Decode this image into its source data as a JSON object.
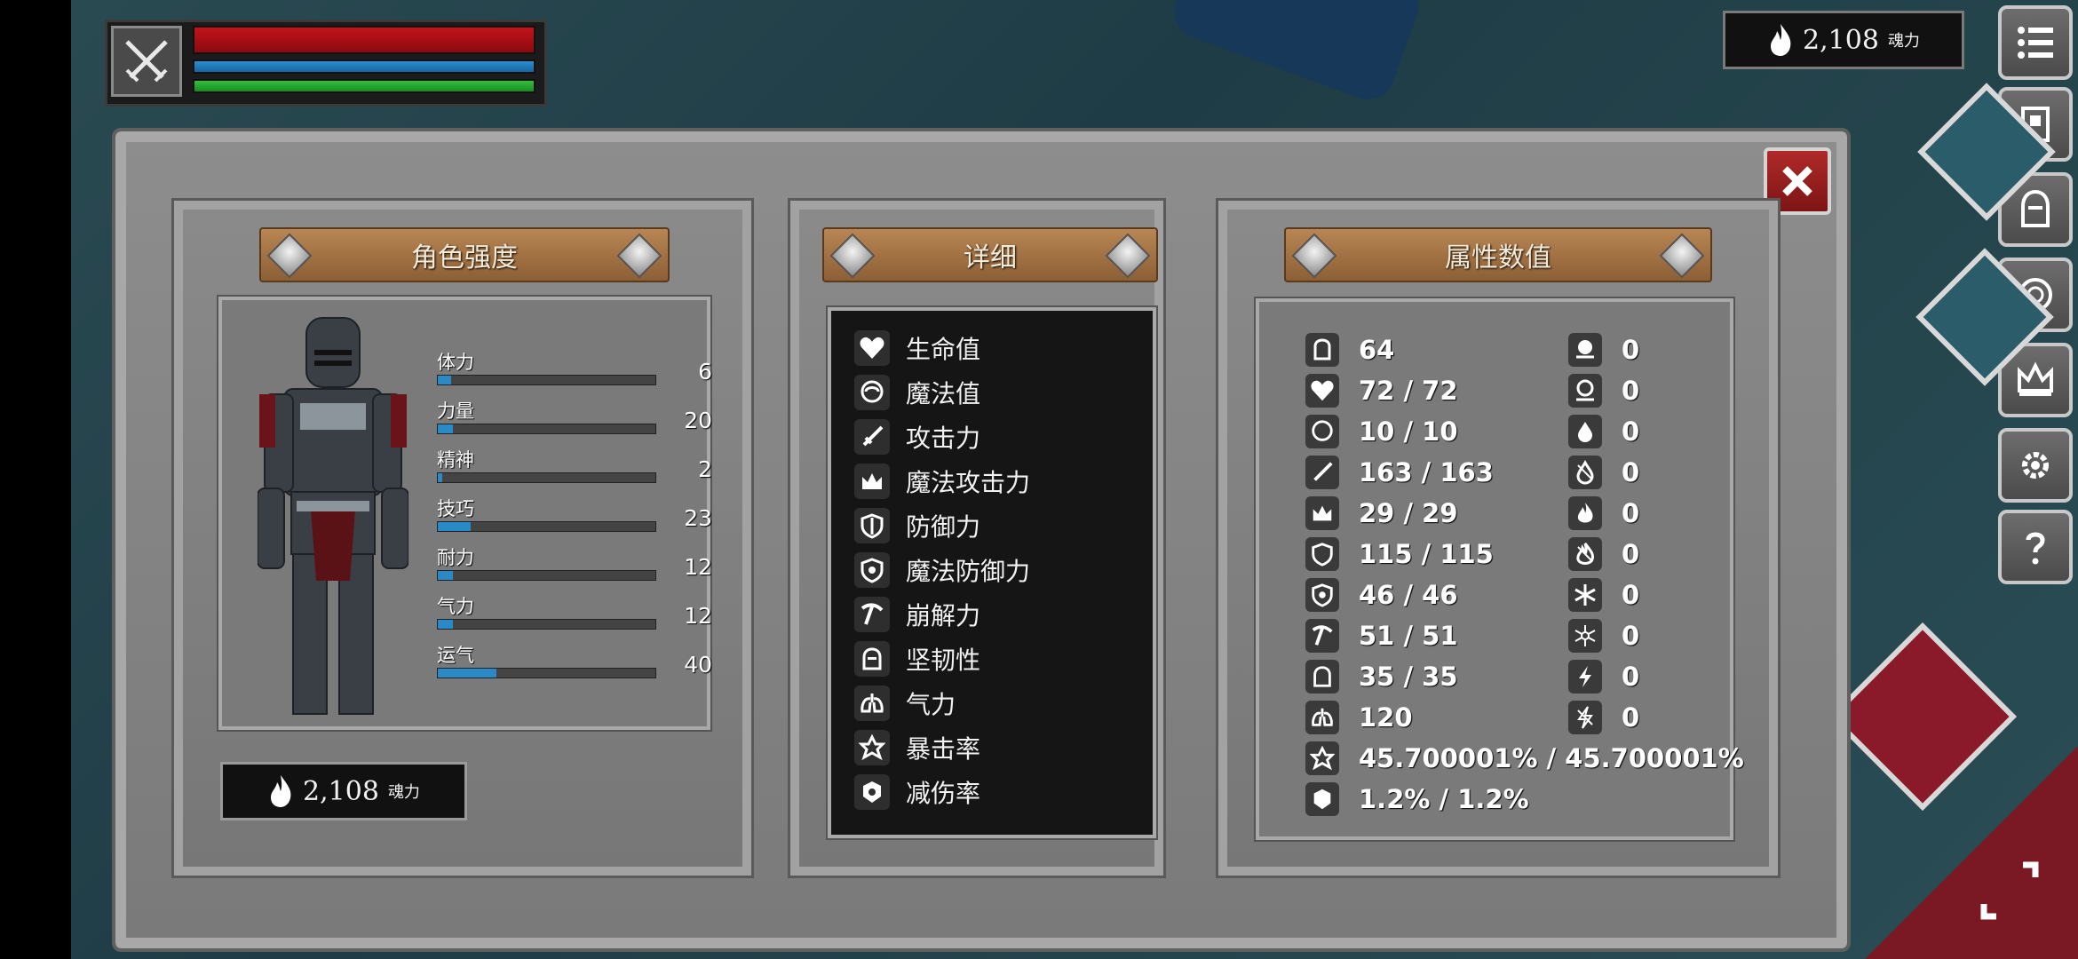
{
  "hud": {
    "soul_value": "2,108",
    "soul_unit": "魂力"
  },
  "panel": {
    "character": {
      "title": "角色强度",
      "stats": [
        {
          "label": "体力",
          "value": "6",
          "fill": 0.06
        },
        {
          "label": "力量",
          "value": "20",
          "fill": 0.07
        },
        {
          "label": "精神",
          "value": "2",
          "fill": 0.02
        },
        {
          "label": "技巧",
          "value": "23",
          "fill": 0.15
        },
        {
          "label": "耐力",
          "value": "12",
          "fill": 0.07
        },
        {
          "label": "气力",
          "value": "12",
          "fill": 0.07
        },
        {
          "label": "运气",
          "value": "40",
          "fill": 0.27
        }
      ],
      "soul_value": "2,108",
      "soul_unit": "魂力"
    },
    "detail": {
      "title": "详细",
      "items": [
        {
          "label": "生命值",
          "icon": "heart-icon"
        },
        {
          "label": "魔法值",
          "icon": "head-icon"
        },
        {
          "label": "攻击力",
          "icon": "sword-icon"
        },
        {
          "label": "魔法攻击力",
          "icon": "crown-icon"
        },
        {
          "label": "防御力",
          "icon": "shield-icon"
        },
        {
          "label": "魔法防御力",
          "icon": "magic-shield-icon"
        },
        {
          "label": "崩解力",
          "icon": "pickaxe-icon"
        },
        {
          "label": "坚韧性",
          "icon": "helmet-icon"
        },
        {
          "label": "气力",
          "icon": "lungs-icon"
        },
        {
          "label": "暴击率",
          "icon": "star-icon"
        },
        {
          "label": "减伤率",
          "icon": "badge-icon"
        }
      ]
    },
    "attributes": {
      "title": "属性数值",
      "left": [
        {
          "icon": "armor-icon",
          "value": "64"
        },
        {
          "icon": "heart-icon",
          "value": "72 / 72"
        },
        {
          "icon": "head-icon",
          "value": "10 / 10"
        },
        {
          "icon": "sword-icon",
          "value": "163 / 163"
        },
        {
          "icon": "crown-icon",
          "value": "29 / 29"
        },
        {
          "icon": "shield-icon",
          "value": "115 / 115"
        },
        {
          "icon": "magic-shield-icon",
          "value": "46 / 46"
        },
        {
          "icon": "pickaxe-icon",
          "value": "51 / 51"
        },
        {
          "icon": "helmet-icon",
          "value": "35 / 35"
        },
        {
          "icon": "lungs-icon",
          "value": "120"
        },
        {
          "icon": "star-icon",
          "value": "45.700001% / 45.700001%"
        },
        {
          "icon": "badge-icon",
          "value": "1.2% / 1.2%"
        }
      ],
      "right": [
        {
          "icon": "skull-icon",
          "value": "0"
        },
        {
          "icon": "poison-skull-icon",
          "value": "0"
        },
        {
          "icon": "blood-drop-icon",
          "value": "0"
        },
        {
          "icon": "cut-drop-icon",
          "value": "0"
        },
        {
          "icon": "fire-icon",
          "value": "0"
        },
        {
          "icon": "cut-fire-icon",
          "value": "0"
        },
        {
          "icon": "snowflake-icon",
          "value": "0"
        },
        {
          "icon": "frost-icon",
          "value": "0"
        },
        {
          "icon": "lightning-icon",
          "value": "0"
        },
        {
          "icon": "cut-lightning-icon",
          "value": "0"
        }
      ]
    }
  },
  "colors": {
    "hp_bar": "#c3131a",
    "mp_bar": "#2b8fd2",
    "stamina_bar": "#31c03c",
    "stat_fill": "#2a8ac8",
    "close_button": "#9e2020"
  }
}
